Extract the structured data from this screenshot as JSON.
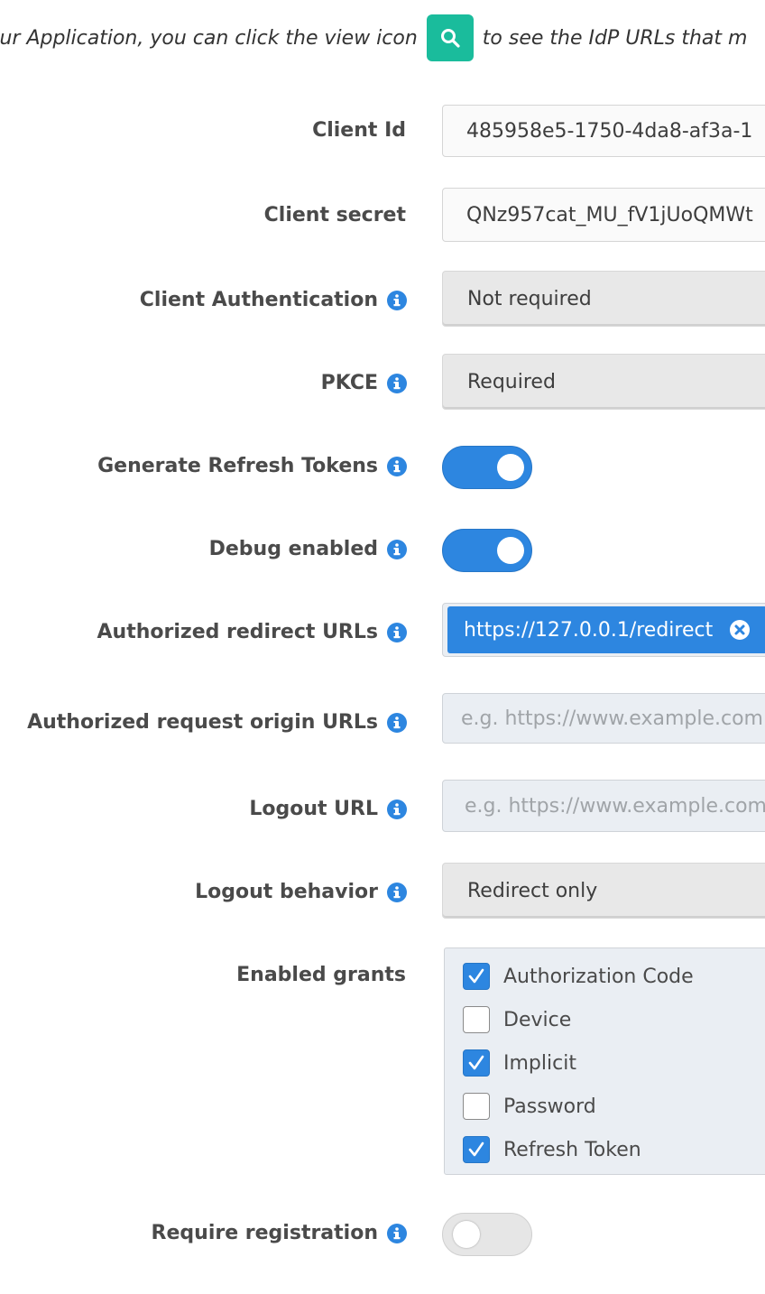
{
  "intro": {
    "before": "our Application, you can click the view icon",
    "after": "to see the IdP URLs that m"
  },
  "colors": {
    "accent": "#2d86e0",
    "view_button": "#1abc9c"
  },
  "fields": {
    "client_id": {
      "label": "Client Id",
      "value": "485958e5-1750-4da8-af3a-1"
    },
    "client_secret": {
      "label": "Client secret",
      "value": "QNz957cat_MU_fV1jUoQMWt"
    },
    "client_authentication": {
      "label": "Client Authentication",
      "value": "Not required"
    },
    "pkce": {
      "label": "PKCE",
      "value": "Required"
    },
    "generate_refresh_tokens": {
      "label": "Generate Refresh Tokens",
      "enabled": true
    },
    "debug_enabled": {
      "label": "Debug enabled",
      "enabled": true
    },
    "authorized_redirect_urls": {
      "label": "Authorized redirect URLs",
      "tags": [
        "https://127.0.0.1/redirect"
      ]
    },
    "authorized_request_origin_urls": {
      "label": "Authorized request origin URLs",
      "placeholder": "e.g. https://www.example.com"
    },
    "logout_url": {
      "label": "Logout URL",
      "placeholder": "e.g. https://www.example.com"
    },
    "logout_behavior": {
      "label": "Logout behavior",
      "value": "Redirect only"
    },
    "enabled_grants": {
      "label": "Enabled grants",
      "options": [
        {
          "label": "Authorization Code",
          "checked": true
        },
        {
          "label": "Device",
          "checked": false
        },
        {
          "label": "Implicit",
          "checked": true
        },
        {
          "label": "Password",
          "checked": false
        },
        {
          "label": "Refresh Token",
          "checked": true
        }
      ]
    },
    "require_registration": {
      "label": "Require registration",
      "enabled": false
    }
  }
}
